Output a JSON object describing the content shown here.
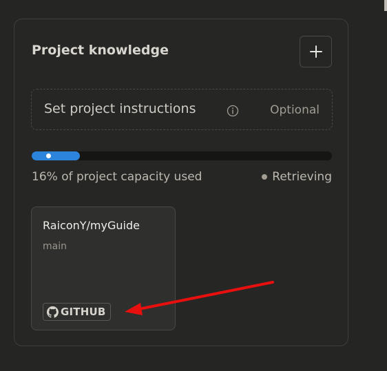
{
  "project_knowledge": {
    "title": "Project knowledge",
    "add_icon": "plus-icon"
  },
  "instructions": {
    "label": "Set project instructions",
    "optional": "Optional",
    "info_icon": "info-icon"
  },
  "capacity": {
    "percent_used": 16,
    "text": "16% of project capacity used",
    "status": "Retrieving",
    "fill_color": "#2c84db"
  },
  "files": [
    {
      "name": "RaiconY/myGuide",
      "branch": "main",
      "source_badge": "GITHUB",
      "badge_icon": "github-icon"
    }
  ],
  "annotation": {
    "arrow_color": "#e8100e"
  }
}
